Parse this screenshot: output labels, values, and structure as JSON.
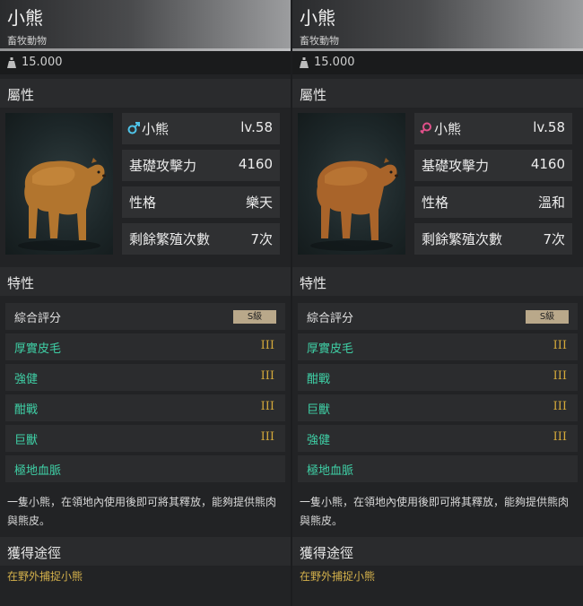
{
  "cards": [
    {
      "title": "小熊",
      "subtitle": "畜牧動物",
      "weight": "15.000",
      "attributes_heading": "屬性",
      "gender_icon": "male-symbol-icon",
      "gender_color": "#4fc3e8",
      "name_label": "小熊",
      "level": "lv.58",
      "attack_label": "基礎攻擊力",
      "attack_value": "4160",
      "personality_label": "性格",
      "personality_value": "樂天",
      "breeding_label": "剩餘繁殖次數",
      "breeding_value": "7次",
      "traits_heading": "特性",
      "rating_label": "綜合評分",
      "rating_badge": "S級",
      "traits": [
        {
          "name": "厚實皮毛",
          "tier": "III"
        },
        {
          "name": "強健",
          "tier": "III"
        },
        {
          "name": "酣戰",
          "tier": "III"
        },
        {
          "name": "巨獸",
          "tier": "III"
        },
        {
          "name": "極地血脈",
          "tier": ""
        }
      ],
      "description": "一隻小熊，在領地內使用後即可將其釋放，能夠提供熊肉與熊皮。",
      "source_heading": "獲得途徑",
      "source_text": "在野外捕捉小熊"
    },
    {
      "title": "小熊",
      "subtitle": "畜牧動物",
      "weight": "15.000",
      "attributes_heading": "屬性",
      "gender_icon": "female-symbol-icon",
      "gender_color": "#e0508a",
      "name_label": "小熊",
      "level": "lv.58",
      "attack_label": "基礎攻擊力",
      "attack_value": "4160",
      "personality_label": "性格",
      "personality_value": "溫和",
      "breeding_label": "剩餘繁殖次數",
      "breeding_value": "7次",
      "traits_heading": "特性",
      "rating_label": "綜合評分",
      "rating_badge": "S級",
      "traits": [
        {
          "name": "厚實皮毛",
          "tier": "III"
        },
        {
          "name": "酣戰",
          "tier": "III"
        },
        {
          "name": "巨獸",
          "tier": "III"
        },
        {
          "name": "強健",
          "tier": "III"
        },
        {
          "name": "極地血脈",
          "tier": ""
        }
      ],
      "description": "一隻小熊，在領地內使用後即可將其釋放，能夠提供熊肉與熊皮。",
      "source_heading": "獲得途徑",
      "source_text": "在野外捕捉小熊"
    }
  ]
}
